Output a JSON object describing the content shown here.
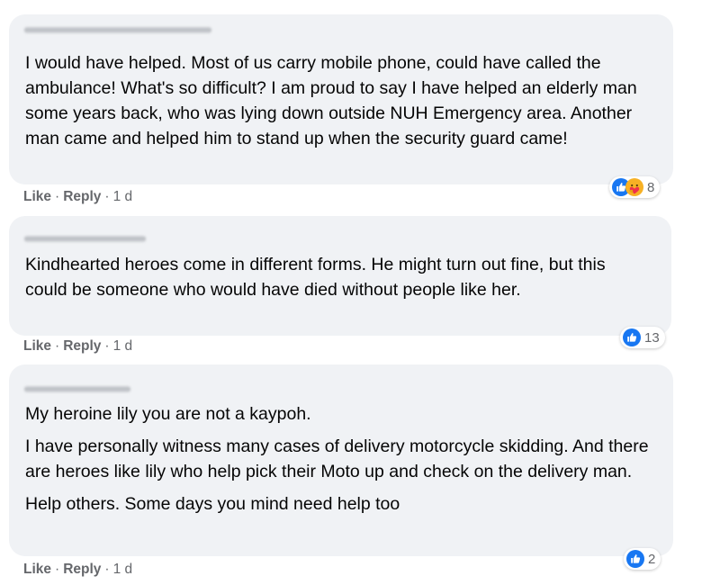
{
  "comments": [
    {
      "paragraphs": [
        "I would have helped. Most of us carry mobile phone, could have called the ambulance! What's so difficult? I am proud to say I have helped an elderly man some years back, who was lying down outside NUH Emergency area. Another man came and helped him to stand up when the security guard came!"
      ],
      "like_label": "Like",
      "reply_label": "Reply",
      "time": "1 d",
      "reaction_icons": [
        "like-icon",
        "care-icon"
      ],
      "reaction_count": "8"
    },
    {
      "paragraphs": [
        "Kindhearted heroes come in different forms. He might turn out fine, but this could be someone who would have died without people like her."
      ],
      "like_label": "Like",
      "reply_label": "Reply",
      "time": "1 d",
      "reaction_icons": [
        "like-icon"
      ],
      "reaction_count": "13"
    },
    {
      "paragraphs": [
        "My heroine lily you are not a kaypoh.",
        "I have personally witness many cases of delivery motorcycle skidding. And there are heroes like lily who help pick their Moto up and check on the delivery man.",
        "Help others. Some days you mind need help too"
      ],
      "like_label": "Like",
      "reply_label": "Reply",
      "time": "1 d",
      "reaction_icons": [
        "like-icon"
      ],
      "reaction_count": "2"
    }
  ],
  "colors": {
    "bubble": "#f0f2f5",
    "like_blue": "#1877f2",
    "care_yellow": "#f7b125",
    "meta_gray": "#65676b"
  }
}
